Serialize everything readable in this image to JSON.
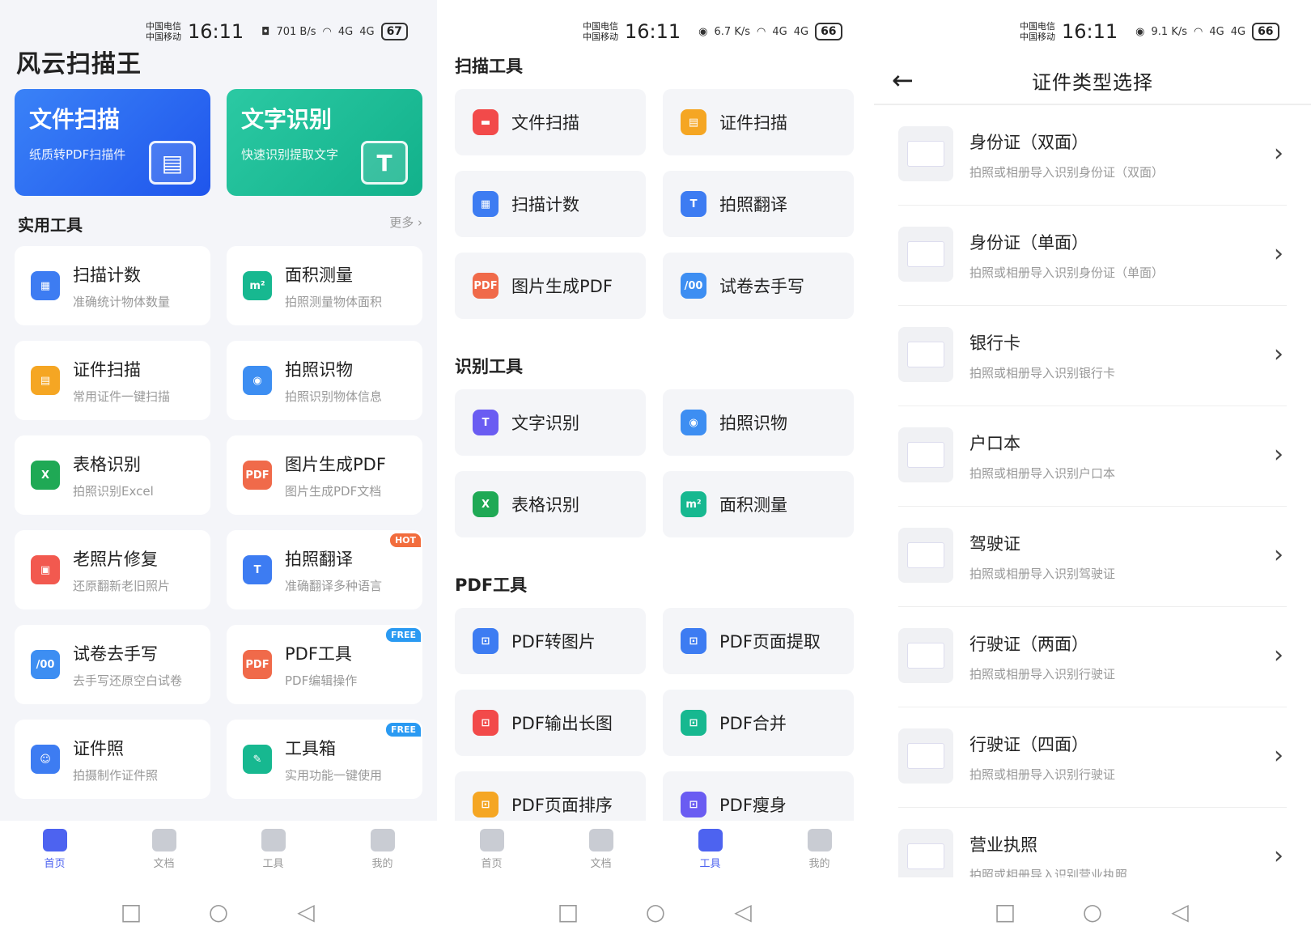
{
  "status": {
    "carrier1": "中国电信",
    "carrier2": "中国移动",
    "time": "16:11",
    "speed_p1": "701 B/s",
    "speed_p2": "6.7 K/s",
    "speed_p3": "9.1 K/s",
    "battery_p1": "67",
    "battery_p2": "66",
    "battery_p3": "66",
    "signal": "4G"
  },
  "p1": {
    "app_title": "风云扫描王",
    "banners": [
      {
        "title": "文件扫描",
        "sub": "纸质转PDF扫描件",
        "color": "#2f6bf2"
      },
      {
        "title": "文字识别",
        "sub": "快速识别提取文字",
        "color": "#1cbf9a"
      }
    ],
    "section_title": "实用工具",
    "more": "更多",
    "tiles": [
      {
        "title": "扫描计数",
        "sub": "准确统计物体数量",
        "icon": "grid-count-icon",
        "color": "#3d7cf2"
      },
      {
        "title": "面积测量",
        "sub": "拍照测量物体面积",
        "icon": "m2-ruler-icon",
        "color": "#17b890"
      },
      {
        "title": "证件扫描",
        "sub": "常用证件一键扫描",
        "icon": "id-card-icon",
        "color": "#f5a623"
      },
      {
        "title": "拍照识物",
        "sub": "拍照识别物体信息",
        "icon": "camera-icon",
        "color": "#3d8ef2"
      },
      {
        "title": "表格识别",
        "sub": "拍照识别Excel",
        "icon": "excel-icon",
        "color": "#1fa955"
      },
      {
        "title": "图片生成PDF",
        "sub": "图片生成PDF文档",
        "icon": "pdf-image-icon",
        "color": "#f06a4a"
      },
      {
        "title": "老照片修复",
        "sub": "还原翻新老旧照片",
        "icon": "photo-repair-icon",
        "color": "#f2594f"
      },
      {
        "title": "拍照翻译",
        "sub": "准确翻译多种语言",
        "icon": "translate-icon",
        "color": "#3d7cf2",
        "badge": "HOT"
      },
      {
        "title": "试卷去手写",
        "sub": "去手写还原空白试卷",
        "icon": "exam-icon",
        "color": "#3d8ef2"
      },
      {
        "title": "PDF工具",
        "sub": "PDF编辑操作",
        "icon": "pdf-tool-icon",
        "color": "#f06a4a",
        "badge": "FREE"
      },
      {
        "title": "证件照",
        "sub": "拍摄制作证件照",
        "icon": "id-photo-icon",
        "color": "#3d7cf2"
      },
      {
        "title": "工具箱",
        "sub": "实用功能一键使用",
        "icon": "toolbox-icon",
        "color": "#17b890",
        "badge": "FREE"
      }
    ],
    "glyphs": [
      "▦",
      "m²",
      "▤",
      "◉",
      "X",
      "PDF",
      "▣",
      "T",
      "/00",
      "PDF",
      "☺",
      "✎"
    ]
  },
  "tabs": [
    {
      "label": "首页",
      "icon": "home-icon"
    },
    {
      "label": "文档",
      "icon": "document-icon"
    },
    {
      "label": "工具",
      "icon": "toolbox-icon"
    },
    {
      "label": "我的",
      "icon": "user-icon"
    }
  ],
  "nav": {
    "square": "□",
    "circle": "○",
    "back": "◁"
  },
  "p2": {
    "sections": [
      {
        "title": "扫描工具",
        "items": [
          {
            "label": "文件扫描",
            "icon": "doc-scan-icon",
            "color": "#f24a4a",
            "g": "▬"
          },
          {
            "label": "证件扫描",
            "icon": "id-card-icon",
            "color": "#f5a623",
            "g": "▤"
          },
          {
            "label": "扫描计数",
            "icon": "grid-count-icon",
            "color": "#3d7cf2",
            "g": "▦"
          },
          {
            "label": "拍照翻译",
            "icon": "translate-icon",
            "color": "#3d7cf2",
            "g": "T"
          },
          {
            "label": "图片生成PDF",
            "icon": "pdf-image-icon",
            "color": "#f06a4a",
            "g": "PDF"
          },
          {
            "label": "试卷去手写",
            "icon": "exam-icon",
            "color": "#3d8ef2",
            "g": "/00"
          }
        ]
      },
      {
        "title": "识别工具",
        "items": [
          {
            "label": "文字识别",
            "icon": "text-recog-icon",
            "color": "#6a5cf2",
            "g": "T"
          },
          {
            "label": "拍照识物",
            "icon": "camera-icon",
            "color": "#3d8ef2",
            "g": "◉"
          },
          {
            "label": "表格识别",
            "icon": "excel-icon",
            "color": "#1fa955",
            "g": "X"
          },
          {
            "label": "面积测量",
            "icon": "m2-ruler-icon",
            "color": "#17b890",
            "g": "m²"
          }
        ]
      },
      {
        "title": "PDF工具",
        "items": [
          {
            "label": "PDF转图片",
            "icon": "pdf-to-image-icon",
            "color": "#3d7cf2",
            "g": "⊡"
          },
          {
            "label": "PDF页面提取",
            "icon": "pdf-extract-icon",
            "color": "#3d7cf2",
            "g": "⊡"
          },
          {
            "label": "PDF输出长图",
            "icon": "pdf-long-image-icon",
            "color": "#f24a4a",
            "g": "⊡"
          },
          {
            "label": "PDF合并",
            "icon": "pdf-merge-icon",
            "color": "#17b890",
            "g": "⊡"
          },
          {
            "label": "PDF页面排序",
            "icon": "pdf-sort-icon",
            "color": "#f5a623",
            "g": "⊡"
          },
          {
            "label": "PDF瘦身",
            "icon": "pdf-compress-icon",
            "color": "#6a5cf2",
            "g": "⊡"
          }
        ]
      }
    ]
  },
  "p3": {
    "back_glyph": "←",
    "chevron": "›",
    "title": "证件类型选择",
    "rows": [
      {
        "title": "身份证（双面）",
        "sub": "拍照或相册导入识别身份证（双面）",
        "icon": "id-card-double-icon"
      },
      {
        "title": "身份证（单面）",
        "sub": "拍照或相册导入识别身份证（单面）",
        "icon": "id-card-single-icon"
      },
      {
        "title": "银行卡",
        "sub": "拍照或相册导入识别银行卡",
        "icon": "bank-card-icon"
      },
      {
        "title": "户口本",
        "sub": "拍照或相册导入识别户口本",
        "icon": "household-register-icon"
      },
      {
        "title": "驾驶证",
        "sub": "拍照或相册导入识别驾驶证",
        "icon": "driver-license-icon"
      },
      {
        "title": "行驶证（两面）",
        "sub": "拍照或相册导入识别行驶证",
        "icon": "vehicle-license-two-icon"
      },
      {
        "title": "行驶证（四面）",
        "sub": "拍照或相册导入识别行驶证",
        "icon": "vehicle-license-four-icon"
      },
      {
        "title": "营业执照",
        "sub": "拍照或相册导入识别营业执照",
        "icon": "business-license-icon"
      }
    ]
  }
}
